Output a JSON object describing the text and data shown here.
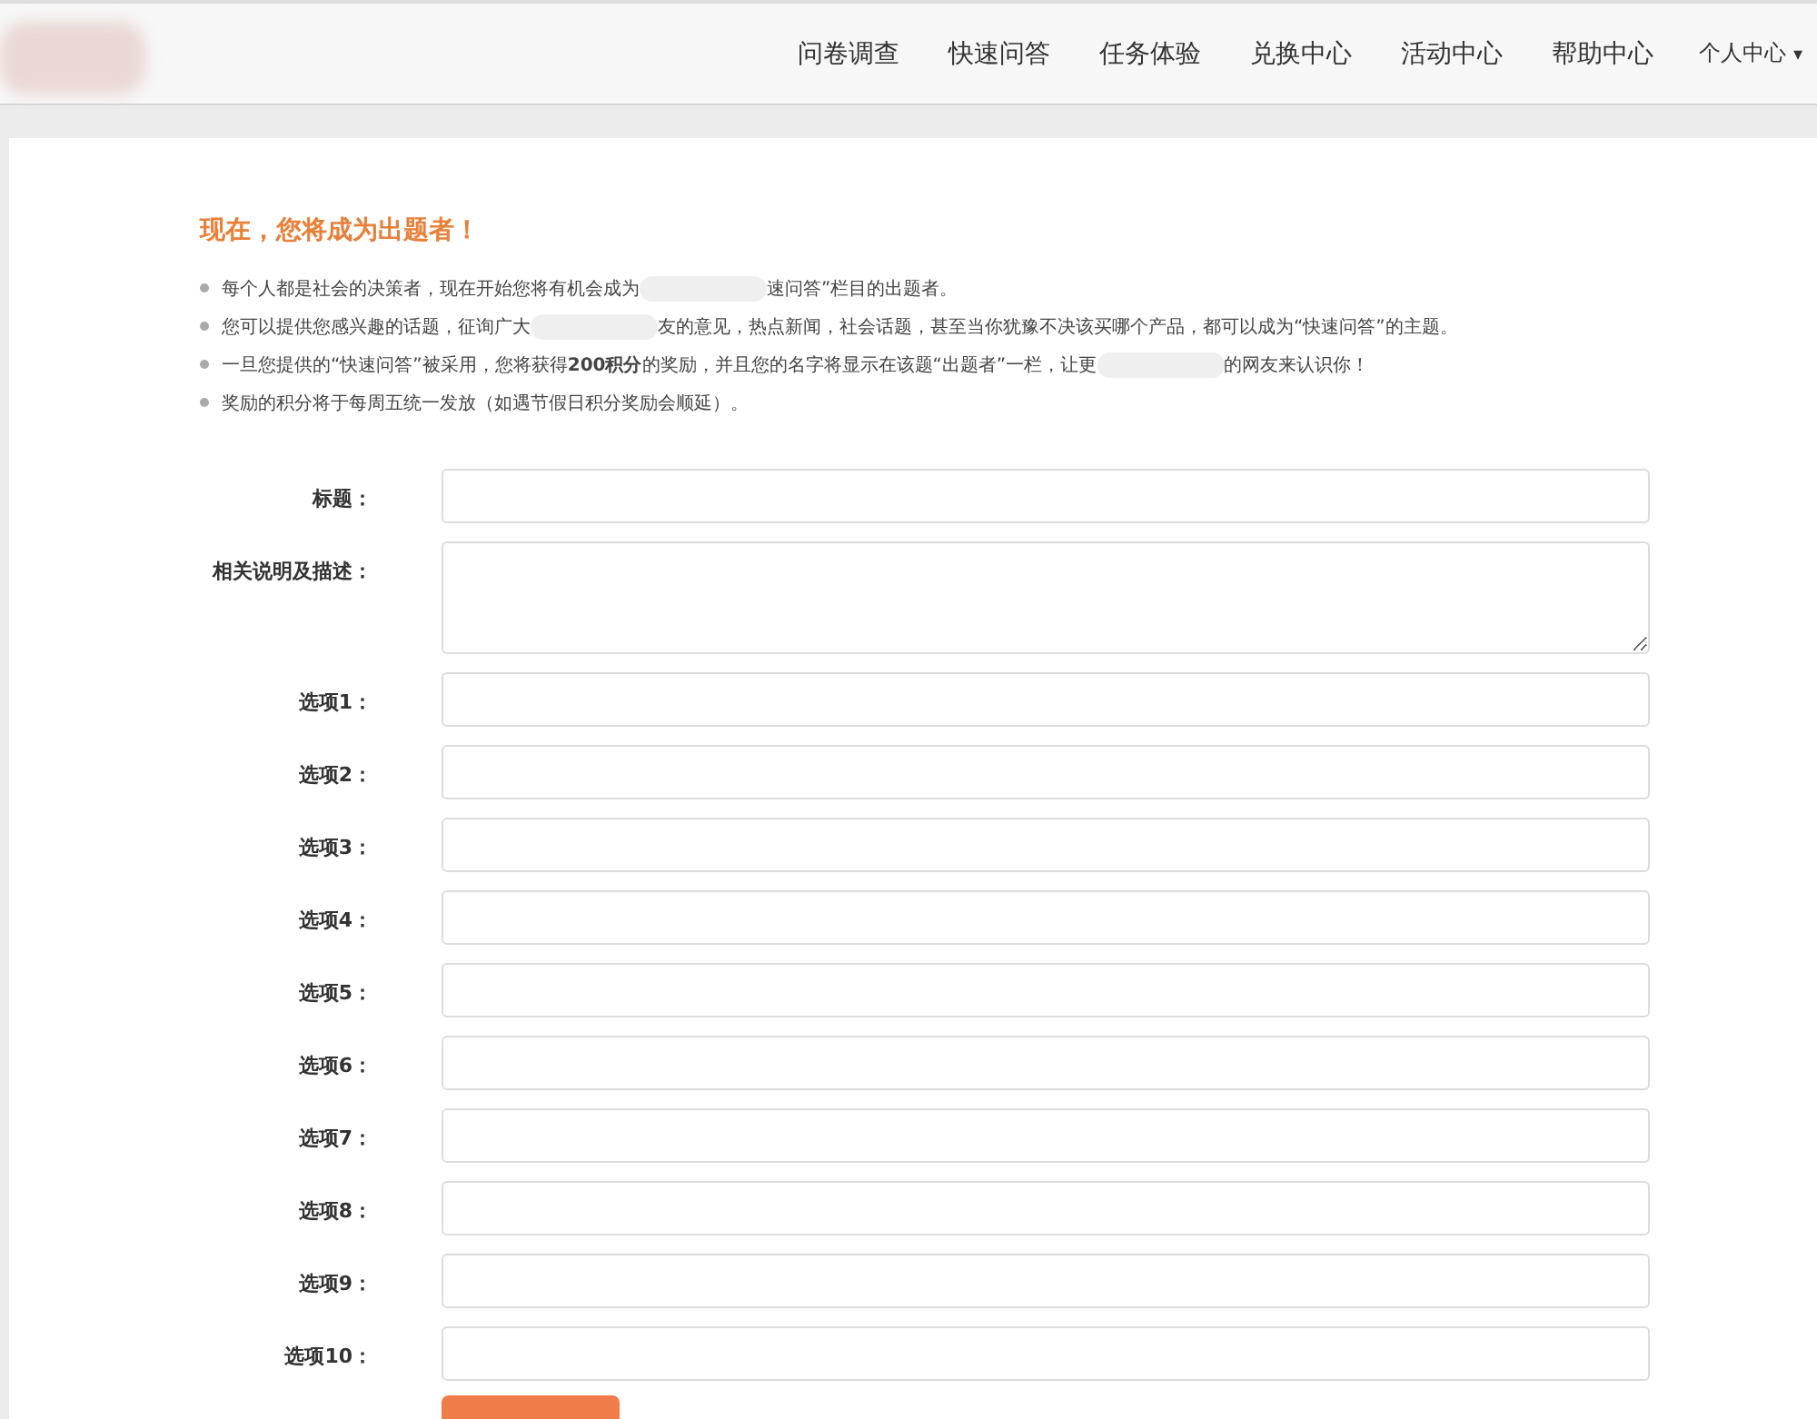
{
  "nav": {
    "items": [
      {
        "label": "问卷调查"
      },
      {
        "label": "快速问答"
      },
      {
        "label": "任务体验"
      },
      {
        "label": "兑换中心"
      },
      {
        "label": "活动中心"
      },
      {
        "label": "帮助中心"
      }
    ],
    "user_menu": {
      "label": "个人中心",
      "caret": "▾"
    }
  },
  "heading": "现在，您将成为出题者！",
  "notes": [
    {
      "before": "每个人都是社会的决策者，现在开始您将有机会成为",
      "after": "速问答”栏目的出题者。"
    },
    {
      "before": "您可以提供您感兴趣的话题，征询广大",
      "after": "友的意见，热点新闻，社会话题，甚至当你犹豫不决该买哪个产品，都可以成为“快速问答”的主题。"
    },
    {
      "before": "一旦您提供的“快速问答”被采用，您将获得**200积分**的奖励，并且您的名字将显示在该题“出题者”一栏，让更",
      "after": "的网友来认识你！"
    },
    {
      "before": "奖励的积分将于每周五统一发放（如遇节假日积分奖励会顺延）。"
    }
  ],
  "form": [
    {
      "label": "标题：",
      "kind": "input"
    },
    {
      "label": "相关说明及描述：",
      "kind": "textarea"
    },
    {
      "label": "选项1：",
      "kind": "input"
    },
    {
      "label": "选项2：",
      "kind": "input"
    },
    {
      "label": "选项3：",
      "kind": "input"
    },
    {
      "label": "选项4：",
      "kind": "input"
    },
    {
      "label": "选项5：",
      "kind": "input"
    },
    {
      "label": "选项6：",
      "kind": "input"
    },
    {
      "label": "选项7：",
      "kind": "input"
    },
    {
      "label": "选项8：",
      "kind": "input"
    },
    {
      "label": "选项9：",
      "kind": "input"
    },
    {
      "label": "选项10：",
      "kind": "input"
    }
  ]
}
